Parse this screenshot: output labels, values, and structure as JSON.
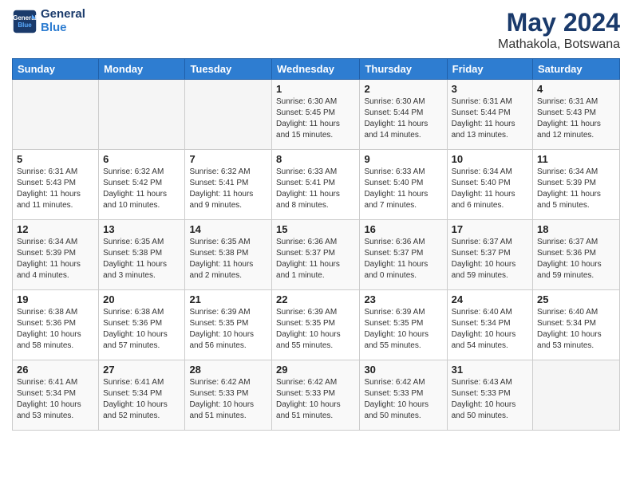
{
  "header": {
    "logo_line1": "General",
    "logo_line2": "Blue",
    "month": "May 2024",
    "location": "Mathakola, Botswana"
  },
  "weekdays": [
    "Sunday",
    "Monday",
    "Tuesday",
    "Wednesday",
    "Thursday",
    "Friday",
    "Saturday"
  ],
  "weeks": [
    [
      {
        "day": "",
        "info": ""
      },
      {
        "day": "",
        "info": ""
      },
      {
        "day": "",
        "info": ""
      },
      {
        "day": "1",
        "info": "Sunrise: 6:30 AM\nSunset: 5:45 PM\nDaylight: 11 hours\nand 15 minutes."
      },
      {
        "day": "2",
        "info": "Sunrise: 6:30 AM\nSunset: 5:44 PM\nDaylight: 11 hours\nand 14 minutes."
      },
      {
        "day": "3",
        "info": "Sunrise: 6:31 AM\nSunset: 5:44 PM\nDaylight: 11 hours\nand 13 minutes."
      },
      {
        "day": "4",
        "info": "Sunrise: 6:31 AM\nSunset: 5:43 PM\nDaylight: 11 hours\nand 12 minutes."
      }
    ],
    [
      {
        "day": "5",
        "info": "Sunrise: 6:31 AM\nSunset: 5:43 PM\nDaylight: 11 hours\nand 11 minutes."
      },
      {
        "day": "6",
        "info": "Sunrise: 6:32 AM\nSunset: 5:42 PM\nDaylight: 11 hours\nand 10 minutes."
      },
      {
        "day": "7",
        "info": "Sunrise: 6:32 AM\nSunset: 5:41 PM\nDaylight: 11 hours\nand 9 minutes."
      },
      {
        "day": "8",
        "info": "Sunrise: 6:33 AM\nSunset: 5:41 PM\nDaylight: 11 hours\nand 8 minutes."
      },
      {
        "day": "9",
        "info": "Sunrise: 6:33 AM\nSunset: 5:40 PM\nDaylight: 11 hours\nand 7 minutes."
      },
      {
        "day": "10",
        "info": "Sunrise: 6:34 AM\nSunset: 5:40 PM\nDaylight: 11 hours\nand 6 minutes."
      },
      {
        "day": "11",
        "info": "Sunrise: 6:34 AM\nSunset: 5:39 PM\nDaylight: 11 hours\nand 5 minutes."
      }
    ],
    [
      {
        "day": "12",
        "info": "Sunrise: 6:34 AM\nSunset: 5:39 PM\nDaylight: 11 hours\nand 4 minutes."
      },
      {
        "day": "13",
        "info": "Sunrise: 6:35 AM\nSunset: 5:38 PM\nDaylight: 11 hours\nand 3 minutes."
      },
      {
        "day": "14",
        "info": "Sunrise: 6:35 AM\nSunset: 5:38 PM\nDaylight: 11 hours\nand 2 minutes."
      },
      {
        "day": "15",
        "info": "Sunrise: 6:36 AM\nSunset: 5:37 PM\nDaylight: 11 hours\nand 1 minute."
      },
      {
        "day": "16",
        "info": "Sunrise: 6:36 AM\nSunset: 5:37 PM\nDaylight: 11 hours\nand 0 minutes."
      },
      {
        "day": "17",
        "info": "Sunrise: 6:37 AM\nSunset: 5:37 PM\nDaylight: 10 hours\nand 59 minutes."
      },
      {
        "day": "18",
        "info": "Sunrise: 6:37 AM\nSunset: 5:36 PM\nDaylight: 10 hours\nand 59 minutes."
      }
    ],
    [
      {
        "day": "19",
        "info": "Sunrise: 6:38 AM\nSunset: 5:36 PM\nDaylight: 10 hours\nand 58 minutes."
      },
      {
        "day": "20",
        "info": "Sunrise: 6:38 AM\nSunset: 5:36 PM\nDaylight: 10 hours\nand 57 minutes."
      },
      {
        "day": "21",
        "info": "Sunrise: 6:39 AM\nSunset: 5:35 PM\nDaylight: 10 hours\nand 56 minutes."
      },
      {
        "day": "22",
        "info": "Sunrise: 6:39 AM\nSunset: 5:35 PM\nDaylight: 10 hours\nand 55 minutes."
      },
      {
        "day": "23",
        "info": "Sunrise: 6:39 AM\nSunset: 5:35 PM\nDaylight: 10 hours\nand 55 minutes."
      },
      {
        "day": "24",
        "info": "Sunrise: 6:40 AM\nSunset: 5:34 PM\nDaylight: 10 hours\nand 54 minutes."
      },
      {
        "day": "25",
        "info": "Sunrise: 6:40 AM\nSunset: 5:34 PM\nDaylight: 10 hours\nand 53 minutes."
      }
    ],
    [
      {
        "day": "26",
        "info": "Sunrise: 6:41 AM\nSunset: 5:34 PM\nDaylight: 10 hours\nand 53 minutes."
      },
      {
        "day": "27",
        "info": "Sunrise: 6:41 AM\nSunset: 5:34 PM\nDaylight: 10 hours\nand 52 minutes."
      },
      {
        "day": "28",
        "info": "Sunrise: 6:42 AM\nSunset: 5:33 PM\nDaylight: 10 hours\nand 51 minutes."
      },
      {
        "day": "29",
        "info": "Sunrise: 6:42 AM\nSunset: 5:33 PM\nDaylight: 10 hours\nand 51 minutes."
      },
      {
        "day": "30",
        "info": "Sunrise: 6:42 AM\nSunset: 5:33 PM\nDaylight: 10 hours\nand 50 minutes."
      },
      {
        "day": "31",
        "info": "Sunrise: 6:43 AM\nSunset: 5:33 PM\nDaylight: 10 hours\nand 50 minutes."
      },
      {
        "day": "",
        "info": ""
      }
    ]
  ]
}
